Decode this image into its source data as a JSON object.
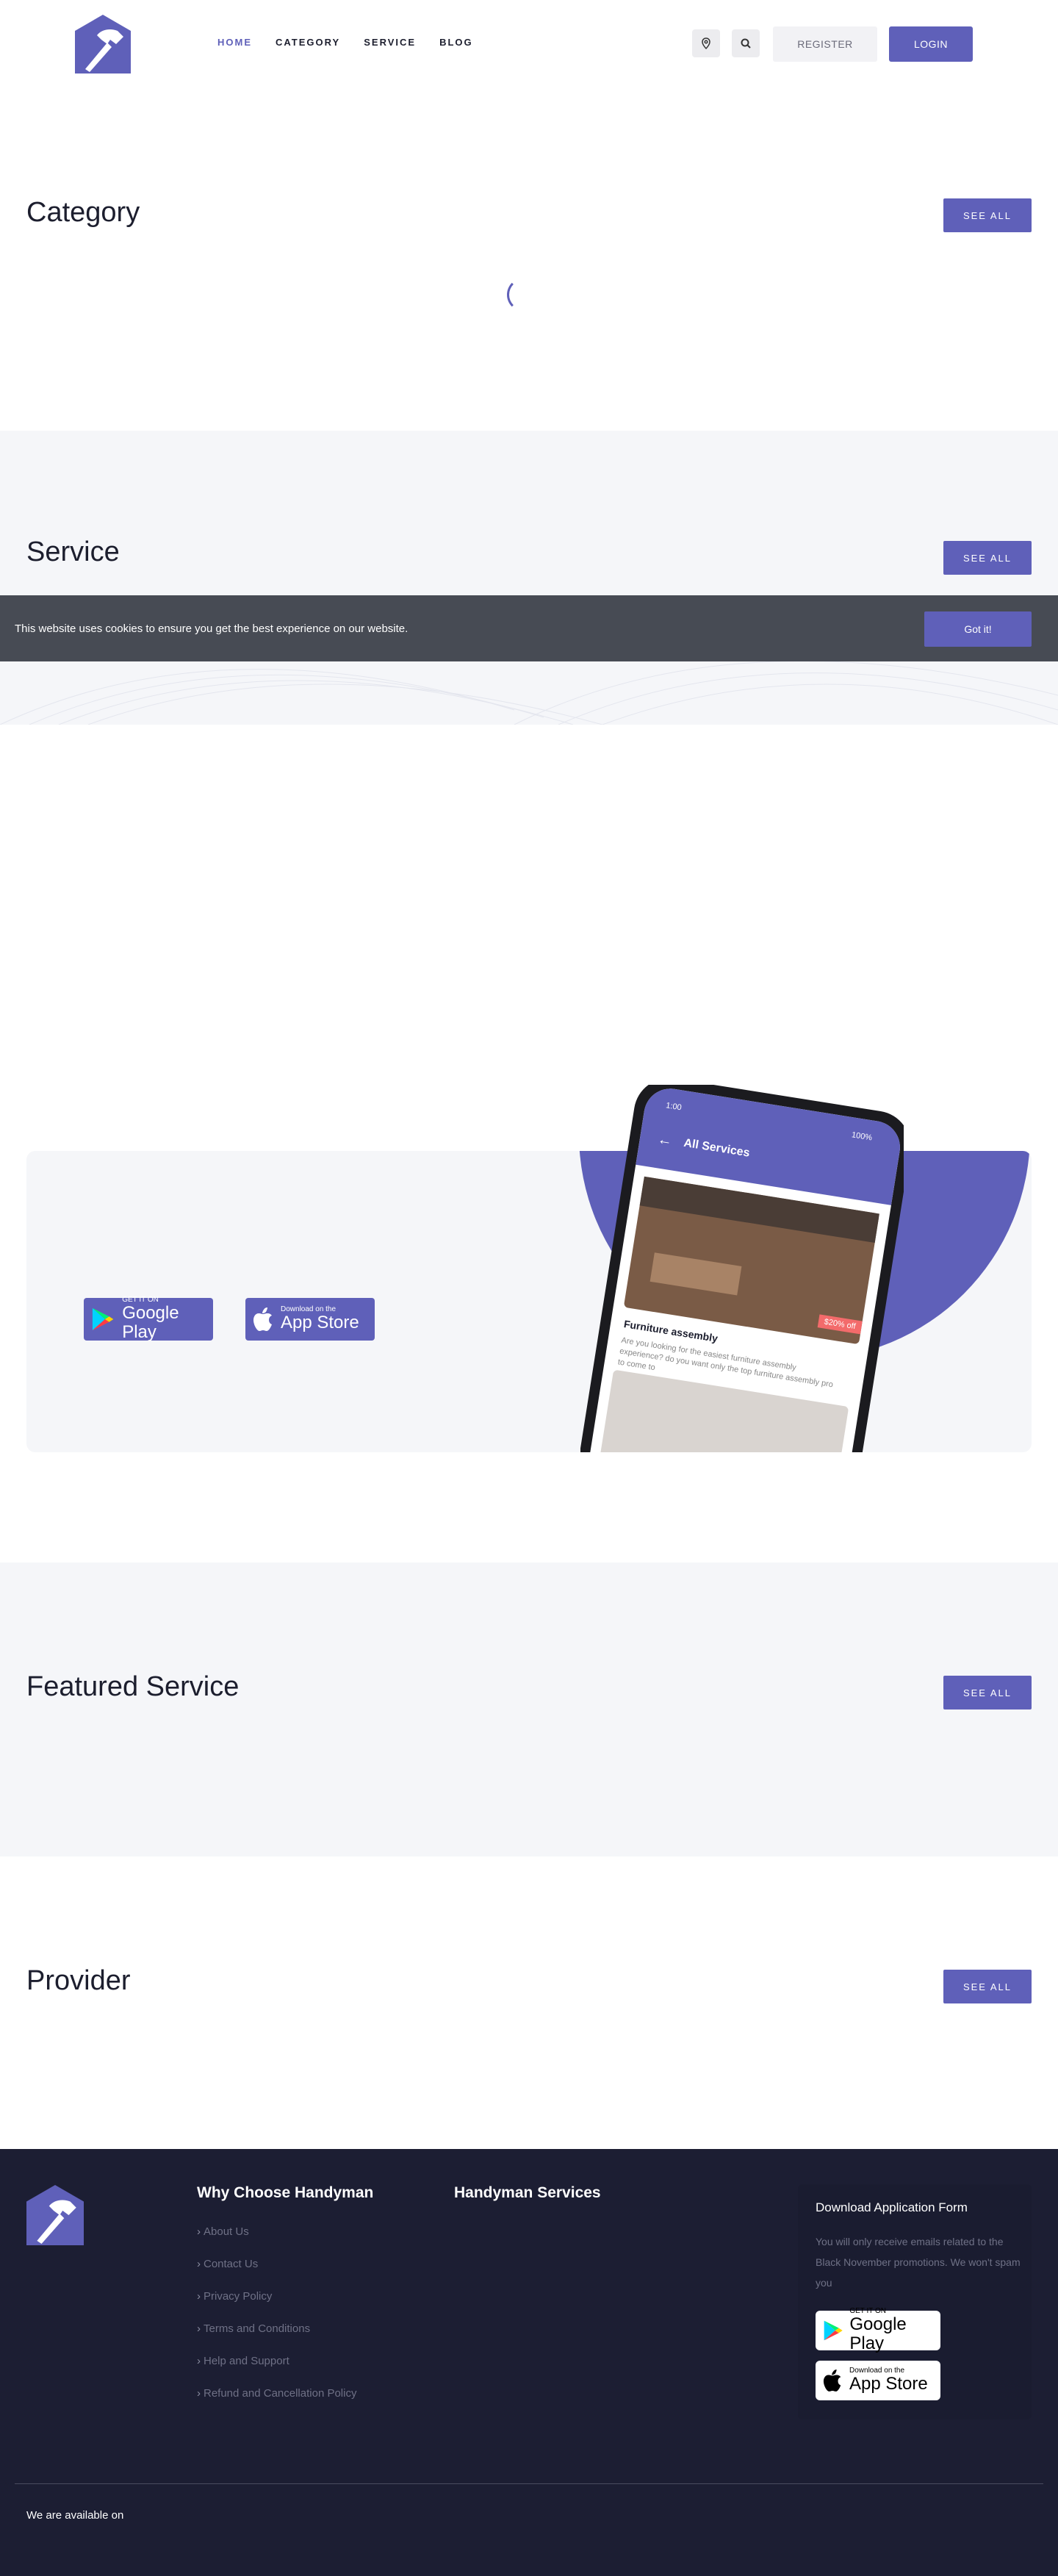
{
  "header": {
    "nav": [
      "HOME",
      "CATEGORY",
      "SERVICE",
      "BLOG"
    ],
    "register_label": "REGISTER",
    "login_label": "LOGIN"
  },
  "category": {
    "title": "Category",
    "see_all": "SEE ALL"
  },
  "service": {
    "title": "Service",
    "see_all": "SEE ALL"
  },
  "cookie": {
    "text": "This website uses cookies to ensure you get the best experience on our website.",
    "button": "Got it!"
  },
  "app_banner": {
    "google_play": {
      "small": "GET IT ON",
      "large": "Google Play"
    },
    "app_store": {
      "small": "Download on the",
      "large": "App Store"
    },
    "phone": {
      "time": "1:00",
      "battery": "100%",
      "screen_title": "All Services",
      "discount_badge": "$20% off",
      "card_title": "Furniture assembly",
      "card_desc": "Are you looking for the easiest furniture assembly experience? do you want only the top furniture assembly pro to come to"
    }
  },
  "featured": {
    "title": "Featured Service",
    "see_all": "SEE ALL"
  },
  "provider": {
    "title": "Provider",
    "see_all": "SEE ALL"
  },
  "footer": {
    "col1_title": "Why Choose Handyman",
    "col1_links": [
      "About Us",
      "Contact Us",
      "Privacy Policy",
      "Terms and Conditions",
      "Help and Support",
      "Refund and Cancellation Policy"
    ],
    "col2_title": "Handyman Services",
    "download_title": "Download Application Form",
    "download_desc": "You will only receive emails related to the Black November promotions. We won't spam you",
    "google_play": {
      "small": "GET IT ON",
      "large": "Google Play"
    },
    "app_store": {
      "small": "Download on the",
      "large": "App Store"
    },
    "available_text": "We are available on"
  },
  "colors": {
    "accent": "#5f60b9",
    "footer_bg": "#1c1e33",
    "cookie_bg": "#474b54",
    "section_bg": "#f5f6f9"
  },
  "icons": [
    "logo-hammer-house",
    "location-pin-icon",
    "search-icon",
    "google-play-icon",
    "apple-icon"
  ]
}
